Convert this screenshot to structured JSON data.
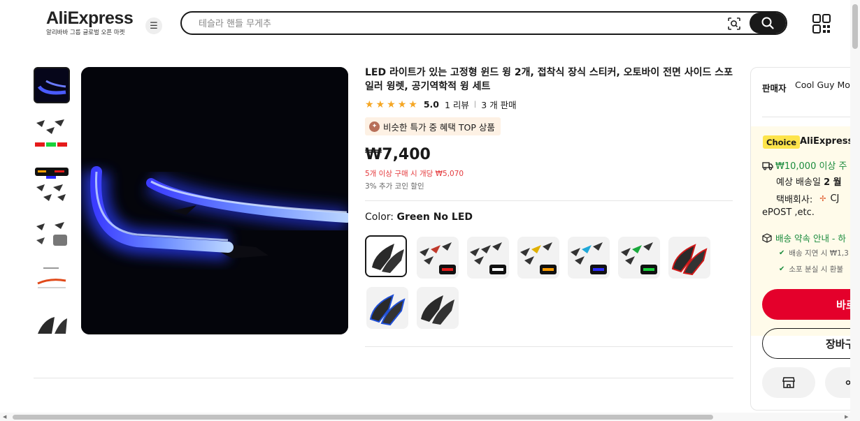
{
  "header": {
    "logo_text": "AliExpress",
    "logo_subtitle": "알리바바 그룹 글로벌 오픈 마켓",
    "menu_icon": "☰",
    "search_placeholder": "테슬라 핸들 무게추"
  },
  "product": {
    "title": "LED 라이트가 있는 고정형 윈드 윙 2개, 접착식 장식 스티커, 오토바이 전면 사이드 스포일러 윙렛, 공기역학적 윙 세트",
    "rating_value": 5.0,
    "rating_text": "5.0",
    "reviews": "1 리뷰",
    "sold": "3 개 판매",
    "promo_badge": "비슷한 특가 중 혜택 TOP 상품",
    "price": "₩7,400",
    "bulk_price": "5개 이상 구매 시 개당 ₩5,070",
    "coin_discount": "3% 추가 코인 할인",
    "color_label": "Color:",
    "color_selected": "Green No LED"
  },
  "gallery": {
    "thumbnails": [
      "blue-led-wing",
      "multi-color-set",
      "led-colors-set",
      "wing-set-on-bike",
      "size-diagram",
      "black-wing"
    ],
    "active_index": 0
  },
  "swatches": [
    {
      "name": "Green No LED",
      "led": "none"
    },
    {
      "name": "Red LED",
      "led": "#e51b1b"
    },
    {
      "name": "White LED",
      "led": "#ffffff"
    },
    {
      "name": "Yellow LED",
      "led": "#ff9d00"
    },
    {
      "name": "Blue LED",
      "led": "#2b2bff"
    },
    {
      "name": "Green LED",
      "led": "#19d13c"
    },
    {
      "name": "Red Trim",
      "led": "#d01818"
    },
    {
      "name": "Blue Trim",
      "led": "#1f4fd6"
    },
    {
      "name": "Black",
      "led": "none"
    }
  ],
  "panel": {
    "seller_label": "판매자",
    "seller_name": "Cool Guy Mo",
    "choice_badge": "Choice",
    "choice_text": "AliExpress",
    "free_ship": "₩10,000 이상 주",
    "delivery_label": "예상 배송일",
    "delivery_value": "2 월",
    "carrier_label": "택배회사:",
    "carrier_value": "CJ",
    "carrier_more": "ePOST ,etc.",
    "promise_title": "배송 약속 안내 - 하",
    "promise_items": [
      "배송 지연 시 ₩1,3",
      "소포 분실 시 환불"
    ],
    "buy_label": "바로",
    "cart_label": "장바구"
  },
  "colors": {
    "accent_red": "#e4002b",
    "green": "#1a8b3c",
    "star": "#f5a623",
    "choice_yellow": "#fde44b"
  }
}
